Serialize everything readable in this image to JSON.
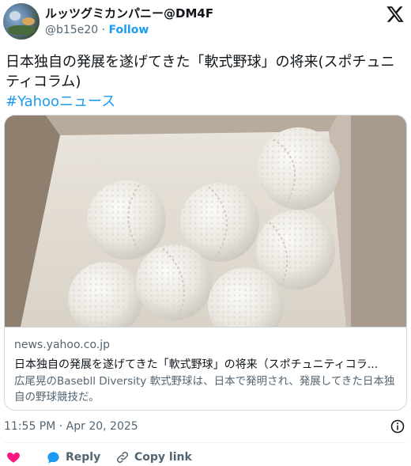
{
  "header": {
    "display_name": "ルッツグミカンパニー@DM4F",
    "handle": "@b15e20",
    "separator": "·",
    "follow_label": "Follow",
    "logo_icon": "x-logo-icon"
  },
  "tweet": {
    "text": "日本独自の発展を遂げてきた「軟式野球」の将来(スポチュニティコラム)",
    "hashtag": "#Yahooニュース"
  },
  "card": {
    "domain": "news.yahoo.co.jp",
    "title": "日本独自の発展を遂げてきた「軟式野球」の将来（スポチュニティコラ...",
    "description": "広尾晃のBasebll Diversity 軟式野球は、日本で発明され、発展してきた日本独自の野球競技だ。"
  },
  "meta": {
    "timestamp": "11:55 PM · Apr 20, 2025",
    "info_icon": "info-icon"
  },
  "actions": {
    "like_icon": "heart-icon",
    "reply_label": "Reply",
    "copy_link_label": "Copy link"
  },
  "colors": {
    "accent": "#1d9bf0",
    "like": "#f91880",
    "muted": "#536471"
  }
}
